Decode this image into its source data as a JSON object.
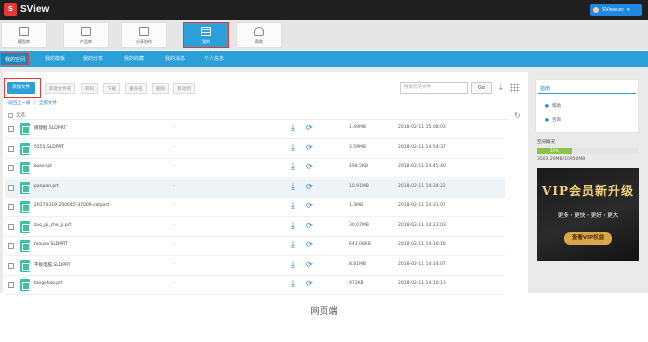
{
  "app": {
    "name": "SView",
    "logo_mark": "S"
  },
  "user": {
    "name": "SView.ec",
    "caret": "▾"
  },
  "nav_tabs": [
    {
      "label": "模型库",
      "icon": "grid-icon"
    },
    {
      "label": "产品库",
      "icon": "box-icon"
    },
    {
      "label": "分享协作",
      "icon": "share-icon"
    },
    {
      "label": "我的",
      "icon": "list-icon",
      "active": true
    },
    {
      "label": "帮助",
      "icon": "heart-icon"
    }
  ],
  "subnav": [
    {
      "label": "我的空间",
      "active": true
    },
    {
      "label": "我的模板"
    },
    {
      "label": "我的分享"
    },
    {
      "label": "我的收藏"
    },
    {
      "label": "我的消息"
    },
    {
      "label": "个人信息"
    }
  ],
  "toolbar": {
    "upload_label": "添加文件",
    "buttons": [
      "新建文件夹",
      "转码",
      "下载",
      "重命名",
      "删除",
      "移动到"
    ],
    "search_placeholder": "搜索您的文件",
    "go_label": "Go"
  },
  "breadcrumb": {
    "back": "返回上一级",
    "sep": "|",
    "all": "全部文件"
  },
  "list_header": {
    "label": "全选"
  },
  "files": [
    {
      "name": "眼镜框.SLDPRT",
      "dash": "-",
      "size": "1.49MB",
      "time": "2018-02-11 15:08:03"
    },
    {
      "name": "5555.SLDPRT",
      "dash": "-",
      "size": "3.59MB",
      "time": "2018-02-11 14:54:37"
    },
    {
      "name": "base.ipt",
      "dash": "-",
      "size": "498.5KB",
      "time": "2018-02-11 14:45:40"
    },
    {
      "name": "panpan.prt",
      "dash": "-",
      "size": "10.91MB",
      "time": "2018-02-11 14:34:22",
      "highlight": true
    },
    {
      "name": "20170319-200645-37009.catpart",
      "dash": "-",
      "size": "1.3MB",
      "time": "2018-02-11 14:31:07"
    },
    {
      "name": "zuo_pi_che_ji.prt",
      "dash": "-",
      "size": "30.07MB",
      "time": "2018-02-11 14:23:03"
    },
    {
      "name": "mouse.SLDPRT",
      "dash": "-",
      "size": "643.08KB",
      "time": "2018-02-11 14:16:18"
    },
    {
      "name": "平板电脑.SLDPRT",
      "dash": "-",
      "size": "8.81MB",
      "time": "2018-02-11 14:14:07"
    },
    {
      "name": "tangshao.prt",
      "dash": "-",
      "size": "972KB",
      "time": "2018-02-11 14:10:13"
    }
  ],
  "sidebar": {
    "title": "指南",
    "links": [
      "帮助",
      "咨询"
    ],
    "usage_label": "空间概况",
    "usage_percent": 34,
    "usage_percent_label": "34%",
    "usage_text": "3503.29MB/10950MB"
  },
  "vip": {
    "title": "VIP会员新升级",
    "subtitle": "更多・更快・更好・更大",
    "cta": "查看VIP权益"
  },
  "caption": "网页端",
  "colors": {
    "accent": "#2aa0d8",
    "highlight_frame": "#e53935",
    "file_icon": "#3cc2a2",
    "usage_fill": "#8bc34a"
  }
}
